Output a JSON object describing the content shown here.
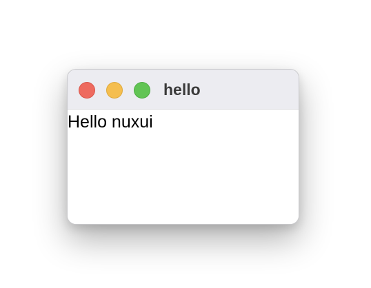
{
  "window": {
    "title": "hello",
    "controls": {
      "close": {
        "icon": "close-traffic-light",
        "color": "#ee6a5f"
      },
      "minimize": {
        "icon": "minimize-traffic-light",
        "color": "#f5be4f"
      },
      "zoom": {
        "icon": "zoom-traffic-light",
        "color": "#61c454"
      }
    },
    "titlebar_color": "#ececf1",
    "background_color": "#ffffff"
  },
  "content": {
    "text": "Hello nuxui"
  }
}
